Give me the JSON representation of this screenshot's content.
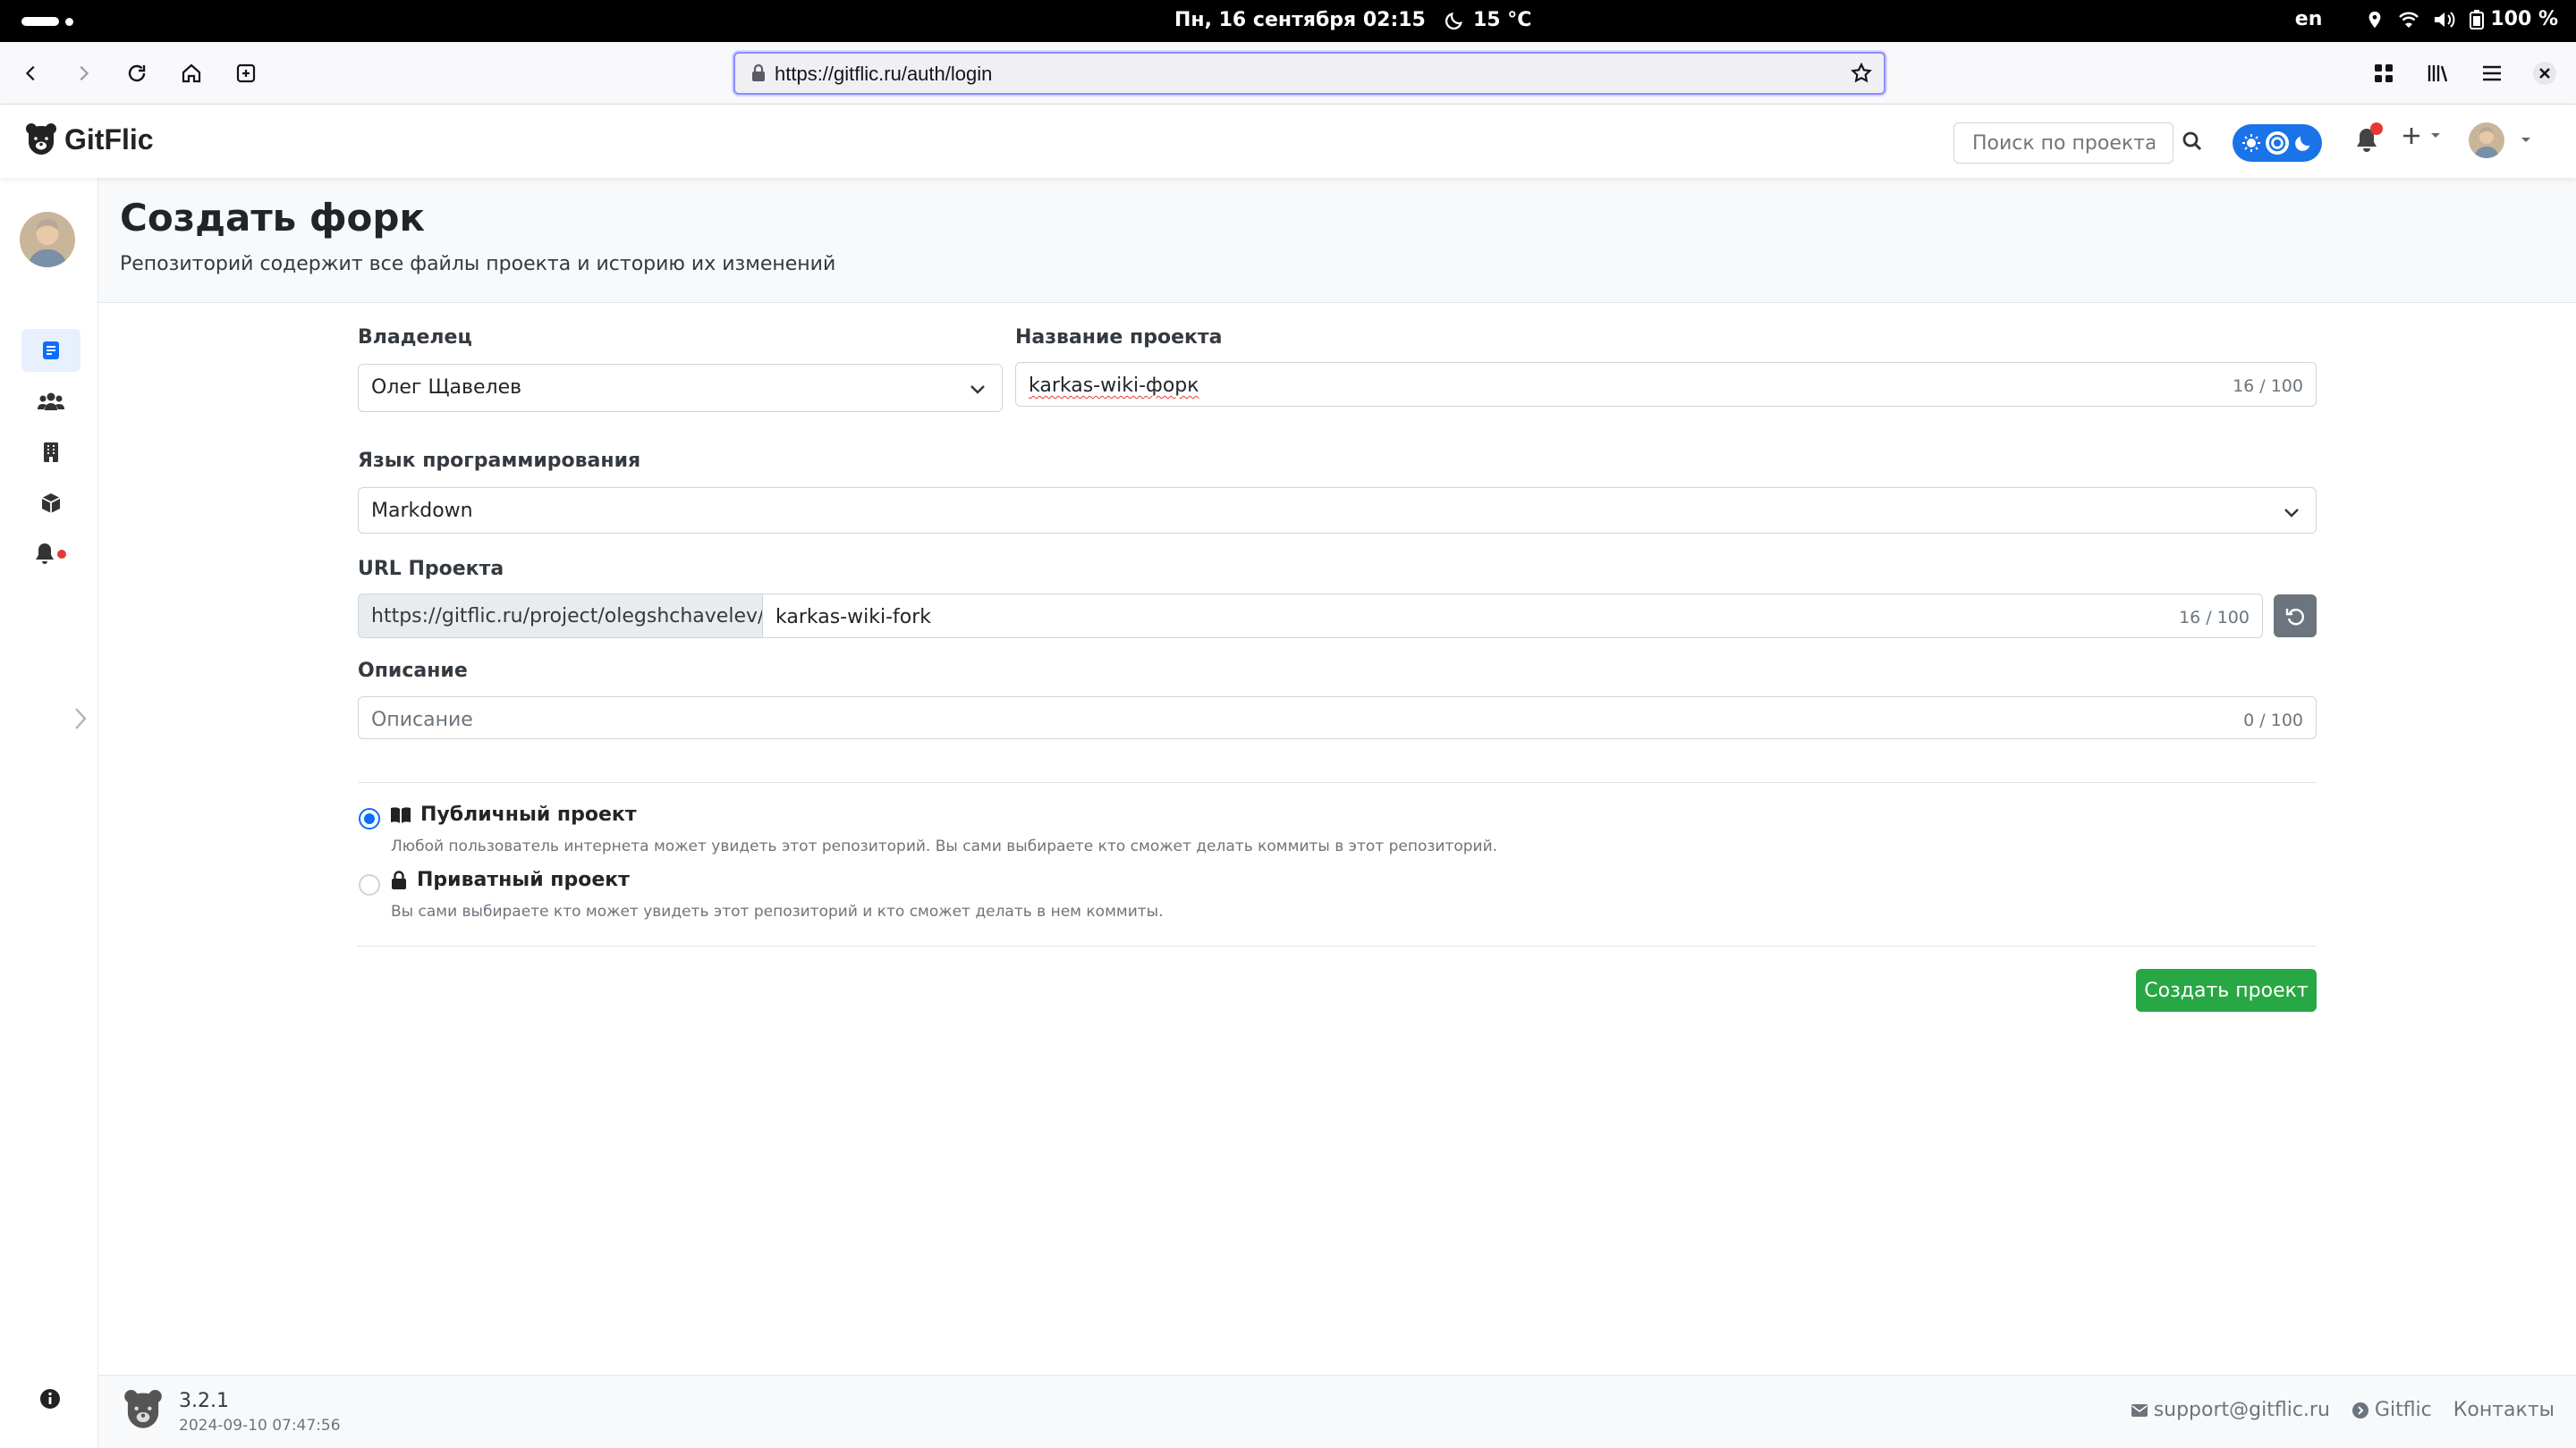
{
  "os": {
    "datetime": "Пн, 16 сентября  02:15",
    "weather": "15 °C",
    "lang": "en",
    "battery": "100 %"
  },
  "browser": {
    "url": "https://gitflic.ru/auth/login"
  },
  "header": {
    "logo_text": "GitFlic",
    "search_placeholder": "Поиск по проекта"
  },
  "page": {
    "title": "Создать форк",
    "subtitle": "Репозиторий содержит все файлы проекта и историю их изменений"
  },
  "form": {
    "owner_label": "Владелец",
    "owner_value": "Олег Щавелев",
    "name_label": "Название проекта",
    "name_value": "karkas-wiki-форк",
    "name_counter": "16 / 100",
    "lang_label": "Язык программирования",
    "lang_value": "Markdown",
    "url_label": "URL Проекта",
    "url_prefix": "https://gitflic.ru/project/olegshchavelev/",
    "url_value": "karkas-wiki-fork",
    "url_counter": "16 / 100",
    "desc_label": "Описание",
    "desc_placeholder": "Описание",
    "desc_counter": "0 / 100",
    "visibility": [
      {
        "title": "Публичный проект",
        "desc": "Любой пользователь интернета может увидеть этот репозиторий. Вы сами выбираете кто сможет делать коммиты в этот репозиторий.",
        "checked": true
      },
      {
        "title": "Приватный проект",
        "desc": "Вы сами выбираете кто может увидеть этот репозиторий и кто сможет делать в нем коммиты.",
        "checked": false
      }
    ],
    "submit_label": "Создать проект"
  },
  "footer": {
    "version": "3.2.1",
    "build_date": "2024-09-10 07:47:56",
    "support_email": "support@gitflic.ru",
    "gitflic_link": "Gitflic",
    "contacts_link": "Контакты"
  },
  "colors": {
    "accent": "#0d6efd",
    "submit": "#28a745",
    "notification": "#e53935",
    "theme_toggle": "#1a73e8"
  },
  "icons": {
    "sidebar": [
      "repository-icon",
      "team-icon",
      "company-icon",
      "package-icon",
      "notifications-icon"
    ]
  }
}
